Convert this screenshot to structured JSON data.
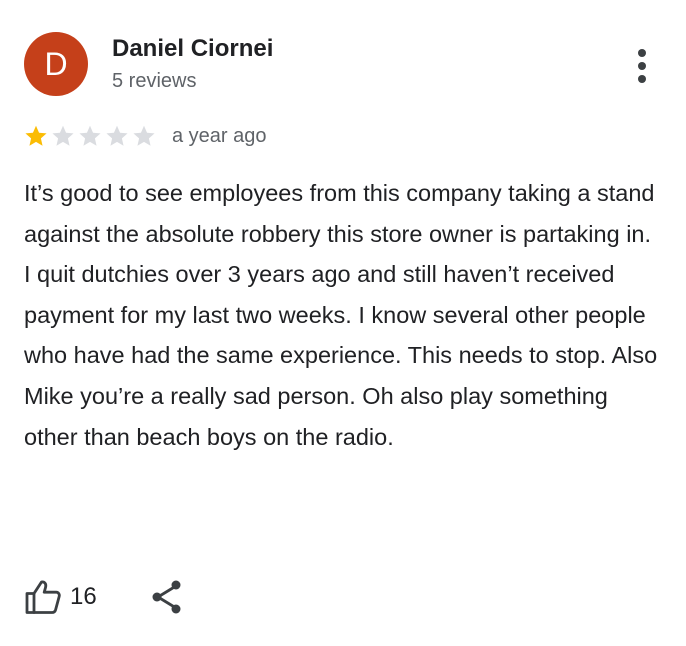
{
  "reviewer": {
    "initial": "D",
    "name": "Daniel Ciornei",
    "meta": "5 reviews",
    "avatar_color": "#c5401a"
  },
  "rating": {
    "value": 1,
    "max": 5,
    "filled_color": "#fbbc04",
    "empty_color": "#dadce0"
  },
  "review": {
    "date": "a year ago",
    "text": "It’s good to see employees from this company taking a stand against the absolute robbery this store owner is partaking in. I quit dutchies over 3 years ago and still haven’t received payment for my last two weeks. I know several other people who have had the same experience. This needs to stop. Also Mike you’re a really sad person. Oh also play something other than beach boys on the radio."
  },
  "actions": {
    "like_count": "16",
    "like_icon": "thumbs-up-icon",
    "share_icon": "share-icon",
    "more_icon": "more-vert-icon"
  }
}
